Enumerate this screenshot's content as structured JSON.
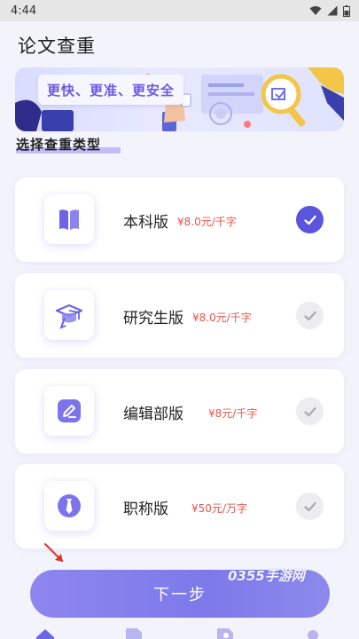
{
  "status_bar": {
    "time": "4:44"
  },
  "app": {
    "title": "论文查重"
  },
  "banner": {
    "slogan": "更快、更准、更安全"
  },
  "section": {
    "title": "选择查重类型"
  },
  "options": [
    {
      "name": "本科版",
      "price": "¥8.0元/千字",
      "icon": "book-icon",
      "selected": true
    },
    {
      "name": "研究生版",
      "price": "¥8.0元/千字",
      "icon": "graduation-cap-icon",
      "selected": false
    },
    {
      "name": "编辑部版",
      "price": "¥8元/千字",
      "icon": "edit-icon",
      "selected": false
    },
    {
      "name": "职称版",
      "price": "¥50元/万字",
      "icon": "tie-icon",
      "selected": false
    }
  ],
  "next_button": {
    "label": "下一步"
  },
  "watermark": {
    "text": "0355手游网"
  },
  "colors": {
    "accent": "#5b55de",
    "price": "#e4564f",
    "button": "#8580ec"
  }
}
